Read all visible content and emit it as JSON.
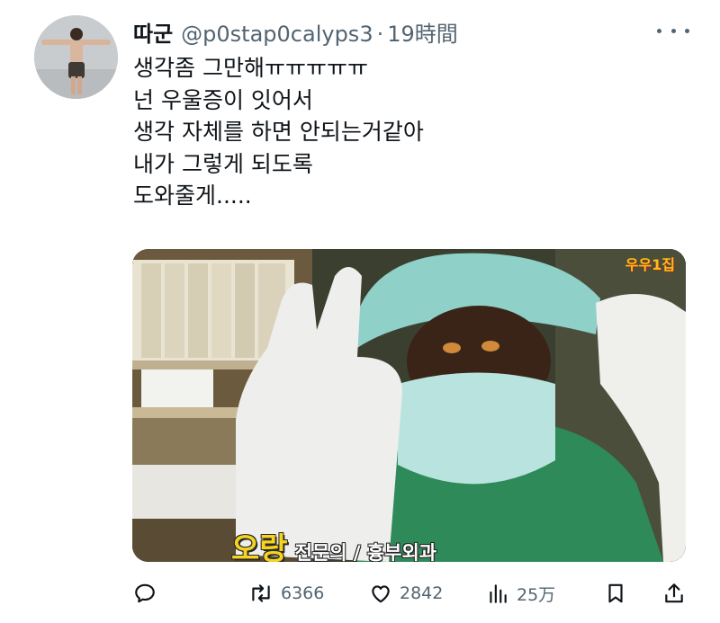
{
  "author": {
    "display_name": "따군",
    "handle": "@p0stap0calyps3",
    "separator": "·",
    "time": "19時間"
  },
  "tweet": {
    "lines": [
      "생각좀 그만해ㅠㅠㅠㅠㅠ",
      "넌 우울증이 잇어서",
      "생각 자체를 하면 안되는거같아",
      "내가 그렇게 되도록",
      "도와줄게....."
    ]
  },
  "media": {
    "caption_name": "오랑",
    "caption_role": "전문의 / 흉부외과",
    "corner_logo": "우우1집"
  },
  "actions": {
    "reply": {
      "icon": "reply-icon"
    },
    "retweet": {
      "icon": "retweet-icon",
      "count": "6366"
    },
    "like": {
      "icon": "like-icon",
      "count": "2842"
    },
    "views": {
      "icon": "views-icon",
      "count": "25万"
    },
    "bookmark": {
      "icon": "bookmark-icon"
    },
    "share": {
      "icon": "share-icon"
    }
  },
  "colors": {
    "text": "#0f1419",
    "secondary": "#536471",
    "caption_yellow": "#f7d31f"
  }
}
